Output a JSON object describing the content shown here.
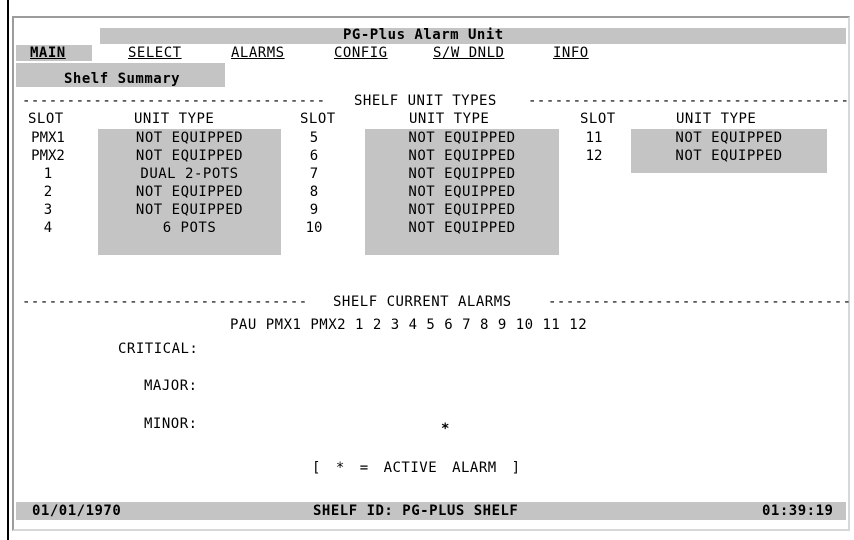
{
  "title": "PG-Plus Alarm Unit",
  "menu": {
    "main": "MAIN",
    "select": "SELECT",
    "alarms": "ALARMS",
    "config": "CONFIG",
    "swdnld": "S/W DNLD",
    "info": "INFO"
  },
  "submenu": "Shelf Summary",
  "unit_types": {
    "section_label": "SHELF UNIT TYPES",
    "col_slot": "SLOT",
    "col_type": "UNIT TYPE",
    "col1": [
      {
        "slot": "PMX1",
        "type": "NOT EQUIPPED"
      },
      {
        "slot": "PMX2",
        "type": "NOT EQUIPPED"
      },
      {
        "slot": "1",
        "type": "DUAL 2-POTS"
      },
      {
        "slot": "2",
        "type": "NOT EQUIPPED"
      },
      {
        "slot": "3",
        "type": "NOT EQUIPPED"
      },
      {
        "slot": "4",
        "type": "6 POTS"
      }
    ],
    "col2": [
      {
        "slot": "5",
        "type": "NOT EQUIPPED"
      },
      {
        "slot": "6",
        "type": "NOT EQUIPPED"
      },
      {
        "slot": "7",
        "type": "NOT EQUIPPED"
      },
      {
        "slot": "8",
        "type": "NOT EQUIPPED"
      },
      {
        "slot": "9",
        "type": "NOT EQUIPPED"
      },
      {
        "slot": "10",
        "type": "NOT EQUIPPED"
      }
    ],
    "col3": [
      {
        "slot": "11",
        "type": "NOT EQUIPPED"
      },
      {
        "slot": "12",
        "type": "NOT EQUIPPED"
      }
    ]
  },
  "current_alarms": {
    "section_label": "SHELF CURRENT ALARMS",
    "header": "PAU PMX1 PMX2 1 2 3 4 5 6 7 8 9 10 11 12",
    "critical_label": "CRITICAL:",
    "major_label": "MAJOR:",
    "minor_label": "MINOR:",
    "minor_marker": "*",
    "legend": "[ * = ACTIVE ALARM ]"
  },
  "status": {
    "date": "01/01/1970",
    "shelf_id": "SHELF ID: PG-PLUS SHELF",
    "time": "01:39:19"
  },
  "colors": {
    "field_bg": "#c4c4c4",
    "text": "#000000",
    "background": "#ffffff"
  }
}
